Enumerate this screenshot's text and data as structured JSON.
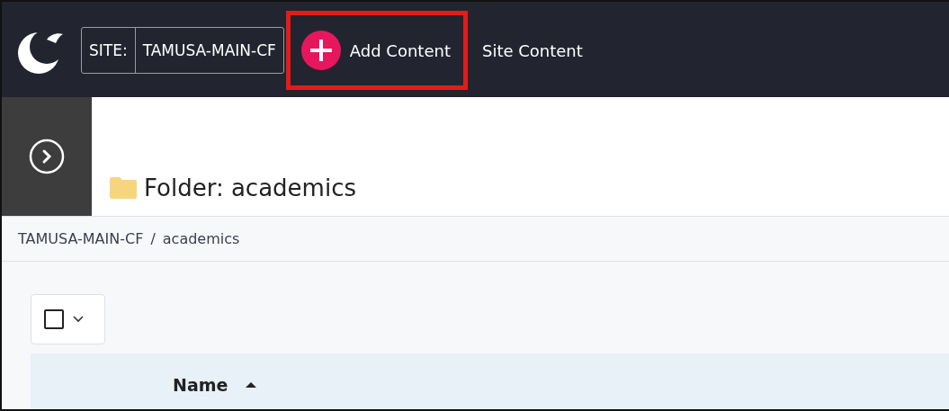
{
  "site_switcher": {
    "label": "SITE:",
    "site": "TAMUSA-MAIN-CF"
  },
  "nav": [
    {
      "kind": "add",
      "label": "Add Content",
      "highlighted": true
    },
    {
      "kind": "link",
      "label": "Site Content",
      "highlighted": false
    }
  ],
  "sidebar": {
    "expanded": false
  },
  "page_title": {
    "label": "Folder: academics"
  },
  "breadcrumb": {
    "separator": "/",
    "items": [
      "TAMUSA-MAIN-CF",
      "academics"
    ]
  },
  "bulk_select": {
    "checked": false
  },
  "table": {
    "columns": [
      {
        "label": "Name",
        "sort_ascending": true
      }
    ]
  }
}
